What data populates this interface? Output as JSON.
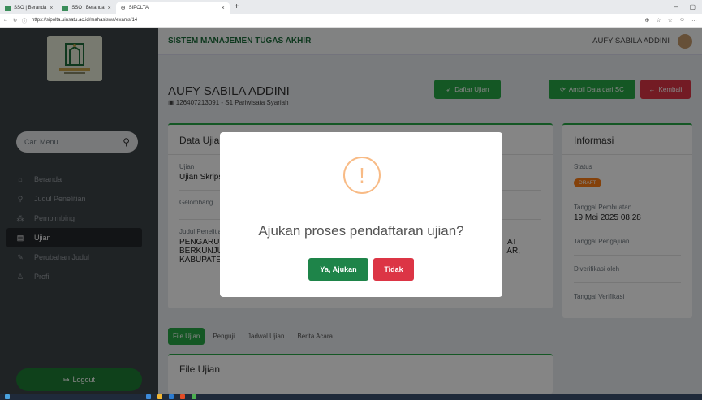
{
  "browser": {
    "tabs": [
      {
        "label": "SSO | Beranda"
      },
      {
        "label": "SSO | Beranda"
      },
      {
        "label": "SIPOLTA"
      }
    ],
    "url": "https://sipolta.uinsatu.ac.id/mahasiswa/exams/14"
  },
  "sidebar": {
    "search_placeholder": "Cari Menu",
    "items": [
      {
        "label": "Beranda",
        "icon": "home-icon"
      },
      {
        "label": "Judul Penelitian",
        "icon": "search-icon"
      },
      {
        "label": "Pembimbing",
        "icon": "users-icon"
      },
      {
        "label": "Ujian",
        "icon": "file-icon"
      },
      {
        "label": "Perubahan Judul",
        "icon": "edit-icon"
      },
      {
        "label": "Profil",
        "icon": "user-icon"
      }
    ],
    "logout_label": "Logout"
  },
  "topnav": {
    "system_title": "SISTEM MANAJEMEN TUGAS AKHIR",
    "user_name": "AUFY SABILA ADDINI"
  },
  "profile": {
    "name": "AUFY SABILA ADDINI",
    "sub": "126407213091 - S1 Pariwisata Syariah"
  },
  "actions": {
    "daftar_ujian": "Daftar Ujian",
    "ambil_data": "Ambil Data dari SC",
    "kembali": "Kembali"
  },
  "data_ujian": {
    "title": "Data Ujian",
    "ujian_label": "Ujian",
    "ujian_value": "Ujian Skripsi",
    "gelombang_label": "Gelombang",
    "judul_label": "Judul Penelitian",
    "judul_line1": "PENGARUH",
    "judul_line1_end": "AT",
    "judul_line2": "BERKUNJUNG",
    "judul_line2_end": "AR,",
    "judul_line3": "KABUPATEN"
  },
  "informasi": {
    "title": "Informasi",
    "status_label": "Status",
    "status_value": "DRAFT",
    "tgl_pembuatan_label": "Tanggal Pembuatan",
    "tgl_pembuatan_value": "19 Mei 2025 08.28",
    "tgl_pengajuan_label": "Tanggal Pengajuan",
    "diverifikasi_label": "Diverifikasi oleh",
    "tgl_verifikasi_label": "Tanggal Verifikasi"
  },
  "tabs": [
    "File Ujian",
    "Penguji",
    "Jadwal Ujian",
    "Berita Acara"
  ],
  "file_ujian_title": "File Ujian",
  "modal": {
    "icon": "!",
    "title": "Ajukan proses pendaftaran ujian?",
    "confirm_label": "Ya, Ajukan",
    "cancel_label": "Tidak"
  },
  "colors": {
    "primary_green": "#28a745",
    "danger_red": "#dc3545",
    "sidebar_bg": "#3d4348",
    "draft_orange": "#fd7e14"
  }
}
